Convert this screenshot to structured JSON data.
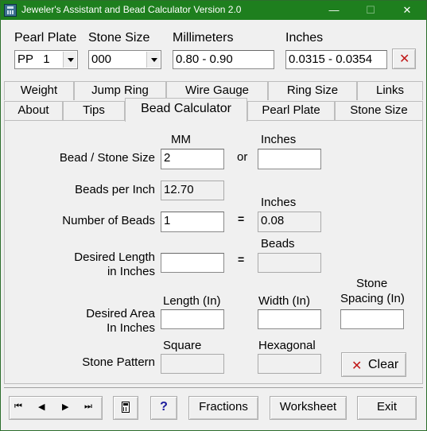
{
  "window": {
    "title": "Jeweler's Assistant and Bead Calculator Version 2.0",
    "minimize": "—",
    "maximize": "☐",
    "close": "✕"
  },
  "top": {
    "pearl_plate_label": "Pearl Plate",
    "pearl_plate_value": "PP   1",
    "stone_size_label": "Stone Size",
    "stone_size_value": "000",
    "millimeters_label": "Millimeters",
    "millimeters_value": "0.80 - 0.90",
    "inches_label": "Inches",
    "inches_value": "0.0315 - 0.0354",
    "clear_icon": "x-icon"
  },
  "tabs_row1": [
    "Weight",
    "Jump Ring",
    "Wire Gauge",
    "Ring Size",
    "Links"
  ],
  "tabs_row2": [
    "About",
    "Tips",
    "Bead Calculator",
    "Pearl Plate",
    "Stone Size"
  ],
  "active_tab": "Bead Calculator",
  "calc": {
    "mm_header": "MM",
    "or_label": "or",
    "inches_header": "Inches",
    "bead_size_label": "Bead / Stone Size",
    "bead_size_mm": "2",
    "bead_size_in": "",
    "beads_per_inch_label": "Beads per Inch",
    "beads_per_inch_value": "12.70",
    "num_beads_inches_header": "Inches",
    "num_beads_label": "Number of Beads",
    "num_beads_value": "1",
    "equals": "=",
    "num_beads_result": "0.08",
    "beads_header": "Beads",
    "desired_length_label_1": "Desired Length",
    "desired_length_label_2": "in Inches",
    "desired_length_value": "",
    "desired_length_result": "",
    "desired_area_label_1": "Desired Area",
    "desired_area_label_2": "In Inches",
    "length_header": "Length (In)",
    "width_header": "Width (In)",
    "spacing_header_1": "Stone",
    "spacing_header_2": "Spacing (In)",
    "area_length_value": "",
    "area_width_value": "",
    "area_spacing_value": "",
    "stone_pattern_label": "Stone Pattern",
    "square_header": "Square",
    "hexagonal_header": "Hexagonal",
    "square_value": "",
    "hexagonal_value": "",
    "clear_label": "Clear"
  },
  "bottom": {
    "first": "⏮",
    "prev": "◀",
    "next": "▶",
    "last": "⏭",
    "help": "?",
    "fractions": "Fractions",
    "worksheet": "Worksheet",
    "exit": "Exit"
  }
}
